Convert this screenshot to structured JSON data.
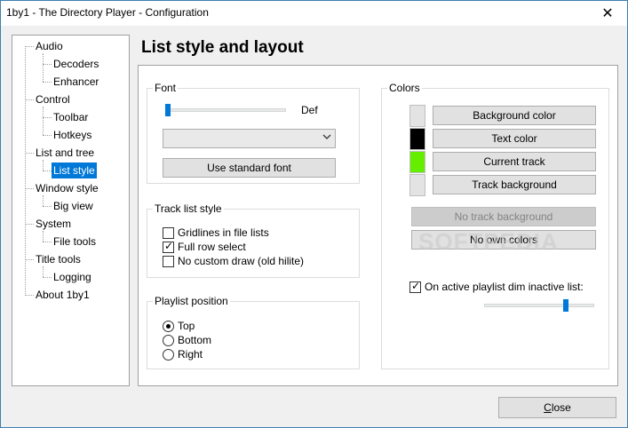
{
  "window": {
    "title": "1by1 - The Directory Player - Configuration",
    "close_glyph": "✕"
  },
  "tree": {
    "items": [
      {
        "label": "Audio",
        "level": 0
      },
      {
        "label": "Decoders",
        "level": 1
      },
      {
        "label": "Enhancer",
        "level": 1
      },
      {
        "label": "Control",
        "level": 0
      },
      {
        "label": "Toolbar",
        "level": 1
      },
      {
        "label": "Hotkeys",
        "level": 1
      },
      {
        "label": "List and tree",
        "level": 0
      },
      {
        "label": "List style",
        "level": 1,
        "selected": true
      },
      {
        "label": "Window style",
        "level": 0
      },
      {
        "label": "Big view",
        "level": 1
      },
      {
        "label": "System",
        "level": 0
      },
      {
        "label": "File tools",
        "level": 1
      },
      {
        "label": "Title tools",
        "level": 0
      },
      {
        "label": "Logging",
        "level": 1
      },
      {
        "label": "About 1by1",
        "level": 0
      }
    ]
  },
  "page": {
    "title": "List style and layout"
  },
  "font": {
    "group_label": "Font",
    "size_label": "Def",
    "size_slider_level": 0,
    "combo_value": "",
    "use_standard_button": "Use standard font"
  },
  "track_list_style": {
    "group_label": "Track list style",
    "options": [
      {
        "label": "Gridlines in file lists",
        "checked": false
      },
      {
        "label": "Full row select",
        "checked": true
      },
      {
        "label": "No custom draw (old hilite)",
        "checked": false
      }
    ]
  },
  "playlist_position": {
    "group_label": "Playlist position",
    "options": [
      {
        "label": "Top",
        "selected": true
      },
      {
        "label": "Bottom",
        "selected": false
      },
      {
        "label": "Right",
        "selected": false
      }
    ]
  },
  "colors": {
    "group_label": "Colors",
    "buttons": [
      {
        "label": "Background color",
        "swatch": "#e3e3e3"
      },
      {
        "label": "Text color",
        "swatch": "#000000"
      },
      {
        "label": "Current track",
        "swatch": "#66ee00"
      },
      {
        "label": "Track background",
        "swatch": "#e3e3e3"
      }
    ],
    "no_track_background": "No track background",
    "no_own_colors": "No own colors",
    "dim_inactive_label": "On active playlist dim inactive list:",
    "dim_inactive_checked": true,
    "dim_slider_level": 0.75
  },
  "watermark": "SOFTPEDIA",
  "footer": {
    "close_label_underlined": "C",
    "close_label_rest": "lose"
  },
  "accent": "#0078d7"
}
